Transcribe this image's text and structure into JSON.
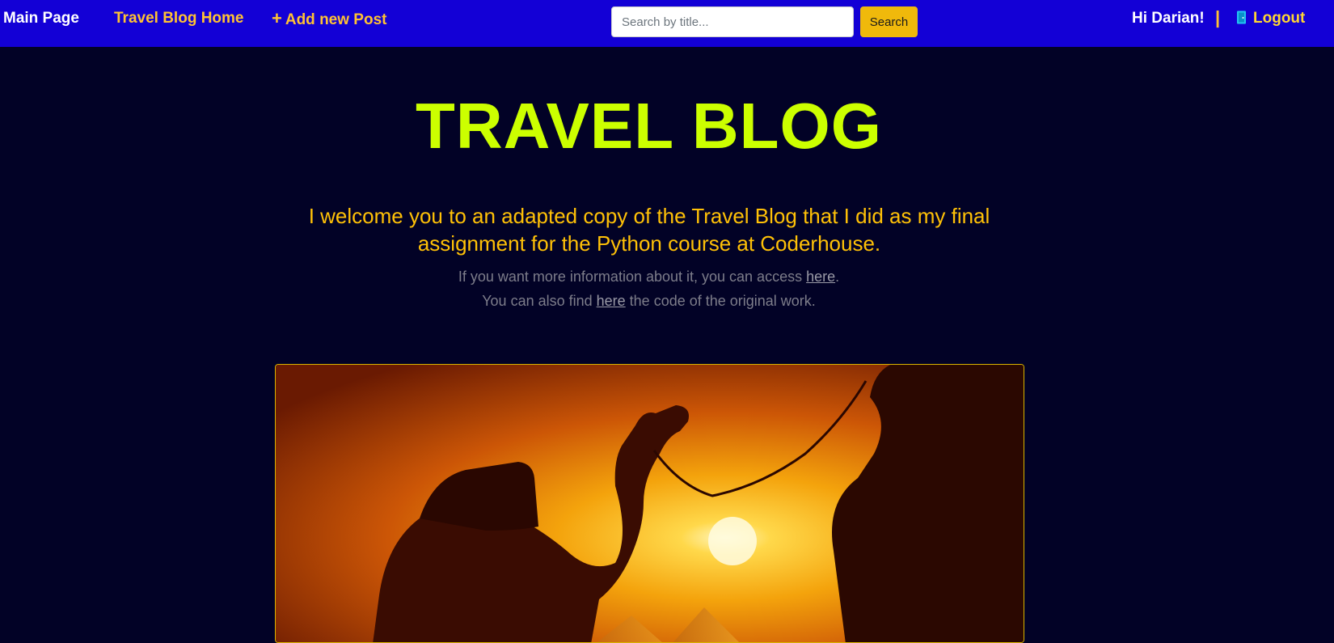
{
  "navbar": {
    "main_page": "Main Page",
    "blog_home": "Travel Blog Home",
    "add_post_plus": "+",
    "add_post": "Add new Post",
    "search_placeholder": "Search by title...",
    "search_button": "Search",
    "greeting": "Hi Darian!",
    "divider": "|",
    "logout": "Logout",
    "logout_icon": "door-icon"
  },
  "hero": {
    "title": "TRAVEL BLOG",
    "welcome": "I welcome you to an adapted copy of the Travel Blog that I did as my final assignment for the Python course at Coderhouse.",
    "info_prefix": "If you want more information about it, you can access ",
    "info_link": "here",
    "info_suffix": ".",
    "code_prefix": "You can also find ",
    "code_link": "here",
    "code_suffix": " the code of the original work."
  },
  "colors": {
    "navbar_bg": "#1300d6",
    "page_bg": "#020226",
    "title": "#ccff00",
    "accent_yellow": "#ffc107",
    "search_button": "#f0b90b"
  }
}
